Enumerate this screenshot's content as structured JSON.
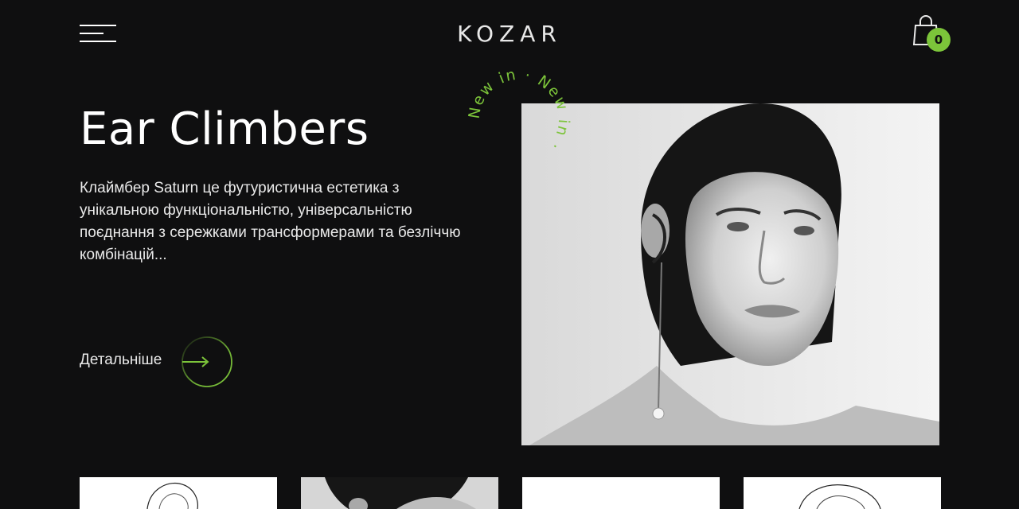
{
  "brand": {
    "logo": "KOZAR"
  },
  "header": {
    "cart_count": "0"
  },
  "hero": {
    "title": "Ear Climbers",
    "description_lines": [
      "Клаймбер Saturn це футуристична естетика з",
      "унікальною функціональністю, універсальністю",
      " поєднання з сережками трансформерами та безліччю",
      "комбінацій..."
    ],
    "cta_label": "Детальніше",
    "badge_text": "New in · New in ·"
  },
  "colors": {
    "background": "#0f0f10",
    "accent": "#7cc43a",
    "text": "#ffffff"
  },
  "icons": {
    "menu": "hamburger-icon",
    "cart": "shopping-bag-icon",
    "cta": "arrow-right-icon"
  },
  "product_cards": [
    {
      "kind": "ear climber product photo, white background"
    },
    {
      "kind": "model portrait photo"
    },
    {
      "kind": "white product photo"
    },
    {
      "kind": "ear climber product photo, white background"
    }
  ]
}
